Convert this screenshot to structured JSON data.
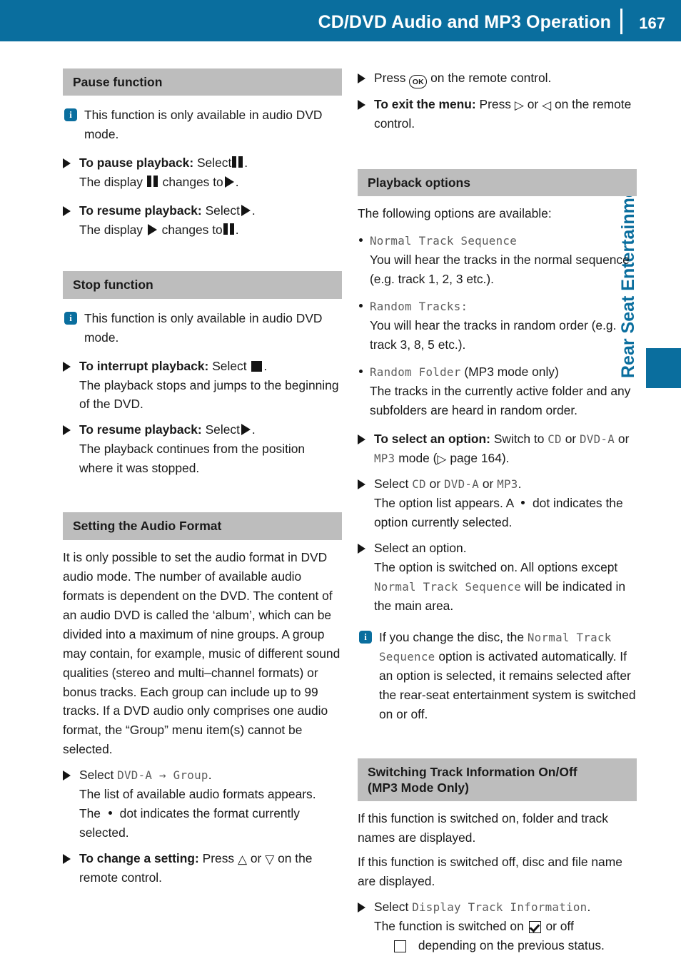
{
  "header": {
    "title": "CD/DVD Audio and MP3 Operation",
    "page_number": "167",
    "band_color": "#0a6e9e"
  },
  "side_tab": {
    "label": "Rear Seat Entertainment",
    "color": "#0a6e9e"
  },
  "left_column": {
    "pause": {
      "heading": "Pause function",
      "note": "This function is only available in audio DVD mode.",
      "step1_lead": "To pause playback:",
      "step1_a": "Select",
      "step1_b": ".",
      "step1_line2_a": "The display",
      "step1_line2_b": "changes to",
      "step1_line2_c": ".",
      "step2_lead": "To resume playback:",
      "step2_a": "Select",
      "step2_b": ".",
      "step2_line2_a": "The display",
      "step2_line2_b": "changes to",
      "step2_line2_c": "."
    },
    "stop": {
      "heading": "Stop function",
      "note": "This function is only available in audio DVD mode.",
      "step1_lead": "To interrupt playback:",
      "step1_a": "Select",
      "step1_b": ".",
      "step1_line2": "The playback stops and jumps to the beginning of the DVD.",
      "step2_lead": "To resume playback:",
      "step2_a": "Select",
      "step2_b": ".",
      "step2_line2": "The playback continues from the position where it was stopped."
    },
    "audio_format": {
      "heading": "Setting the Audio Format",
      "paragraph": "It is only possible to set the audio format in DVD audio mode. The number of available audio formats is dependent on the DVD. The content of an audio DVD is called the ‘album’, which can be divided into a maximum of nine groups. A group may contain, for example, music of different sound qualities (stereo and multi–channel formats) or bonus tracks. Each group can include up to 99 tracks. If a DVD audio only comprises one audio format, the “Group” menu item(s) cannot be selected.",
      "step1_a": "Select",
      "step1_mono": "DVD-A → Group",
      "step1_b": ".",
      "step1_line2": "The list of available audio formats appears.",
      "step1_line3_a": "The",
      "step1_line3_b": "dot indicates the format currently selected.",
      "step2_lead": "To change a setting:",
      "step2_a": "Press",
      "step2_up": "△",
      "step2_or": "or",
      "step2_down": "▽",
      "step2_b": "on the remote control."
    }
  },
  "right_column": {
    "menu_steps": {
      "step1_a": "Press",
      "step1_ok": "OK",
      "step1_b": "on the remote control.",
      "step2_lead": "To exit the menu:",
      "step2_a": "Press",
      "step2_right": "▷",
      "step2_or": "or",
      "step2_left": "◁",
      "step2_b": "on the remote control."
    },
    "playback_options": {
      "heading": "Playback options",
      "intro": "The following options are available:",
      "options": [
        {
          "name": "Normal Track Sequence",
          "suffix": "",
          "description": "You will hear the tracks in the normal sequence (e.g. track 1, 2, 3 etc.)."
        },
        {
          "name": "Random Tracks:",
          "suffix": "",
          "description": "You will hear the tracks in random order (e.g. track 3, 8, 5 etc.)."
        },
        {
          "name": "Random Folder",
          "suffix": "(MP3 mode only)",
          "description": "The tracks in the currently active folder and any subfolders are heard in random order."
        }
      ],
      "step1_lead": "To select an option:",
      "step1_a": "Switch to",
      "step1_m1": "CD",
      "step1_or1": "or",
      "step1_m2": "DVD-A",
      "step1_or2": "or",
      "step1_m3": "MP3",
      "step1_b": "mode (",
      "step1_ref_arrow": "▷",
      "step1_ref": "page 164",
      "step1_c": ").",
      "step2_a": "Select",
      "step2_m1": "CD",
      "step2_or1": "or",
      "step2_m2": "DVD-A",
      "step2_or2": "or",
      "step2_m3": "MP3",
      "step2_b": ".",
      "step2_line2_a": "The option list appears. A",
      "step2_line2_b": "dot indicates the option currently selected.",
      "step3_a": "Select an option.",
      "step3_line2_a": "The option is switched on. All options except",
      "step3_mono": "Normal Track Sequence",
      "step3_line2_b": "will be indicated in the main area.",
      "note_a": "If you change the disc, the",
      "note_mono": "Normal Track Sequence",
      "note_b": "option is activated automatically. If an option is selected, it remains selected after the rear-seat entertainment system is switched on or off."
    },
    "track_info": {
      "heading_line1": "Switching Track Information On/Off",
      "heading_line2": "(MP3 Mode Only)",
      "para1": "If this function is switched on, folder and track names are displayed.",
      "para2": "If this function is switched off, disc and file name are displayed.",
      "step1_a": "Select",
      "step1_mono": "Display Track Information",
      "step1_b": ".",
      "step1_line2_a": "The function is switched on",
      "step1_line2_b": "or off",
      "step1_line3": "depending on the previous status."
    }
  }
}
